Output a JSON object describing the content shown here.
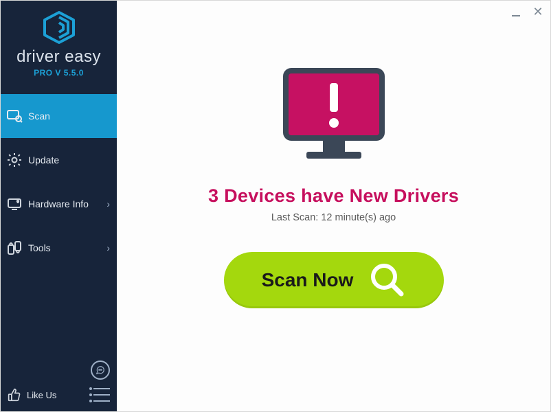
{
  "brand": {
    "name": "driver easy",
    "version_label": "PRO V 5.5.0"
  },
  "sidebar": {
    "items": [
      {
        "id": "scan",
        "label": "Scan",
        "icon": "scan-icon",
        "active": true,
        "has_submenu": false
      },
      {
        "id": "update",
        "label": "Update",
        "icon": "gear-icon",
        "active": false,
        "has_submenu": false
      },
      {
        "id": "hwinfo",
        "label": "Hardware Info",
        "icon": "hardware-icon",
        "active": false,
        "has_submenu": true
      },
      {
        "id": "tools",
        "label": "Tools",
        "icon": "tools-icon",
        "active": false,
        "has_submenu": true
      }
    ],
    "like_us_label": "Like Us"
  },
  "main": {
    "headline": "3 Devices have New Drivers",
    "last_scan_label": "Last Scan: 12 minute(s) ago",
    "scan_button_label": "Scan Now"
  },
  "colors": {
    "sidebar_bg": "#17243a",
    "sidebar_active": "#1698ce",
    "accent_pink": "#c60f5d",
    "accent_green": "#a4d80d",
    "monitor_fill": "#c61162"
  }
}
